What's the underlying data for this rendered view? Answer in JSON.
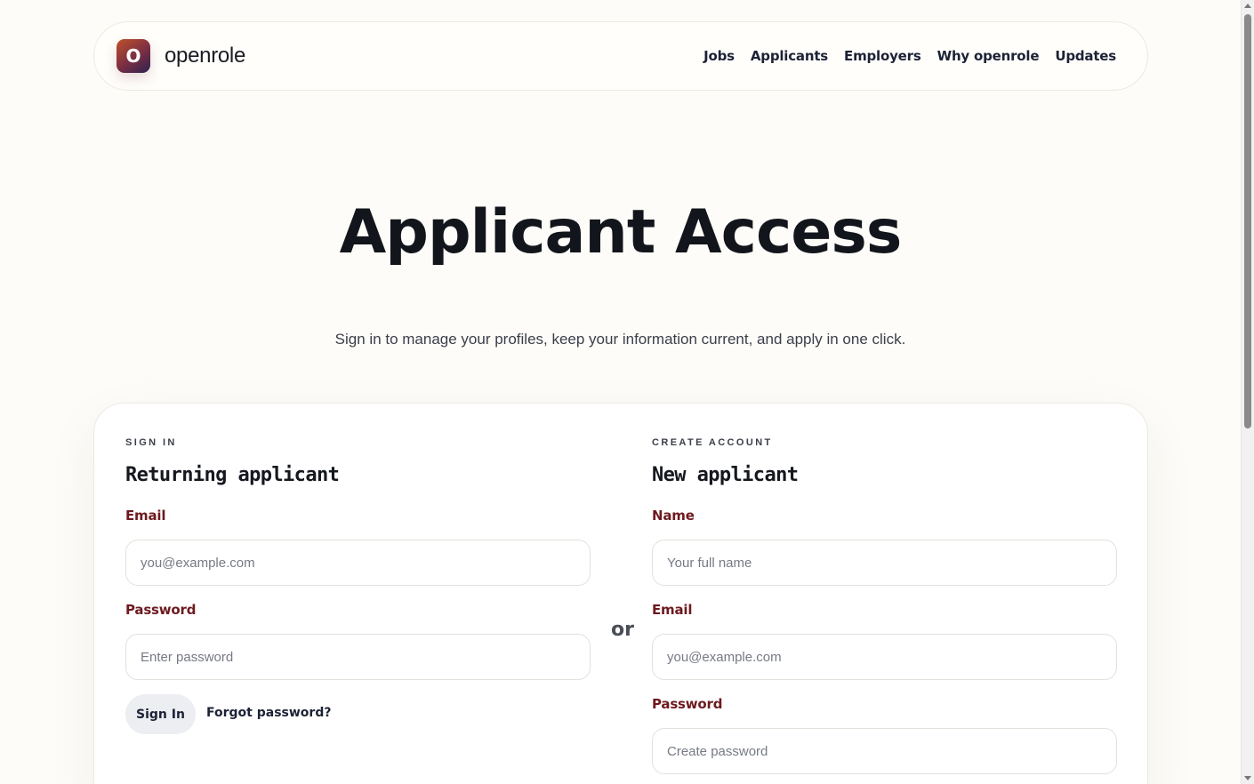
{
  "brand": {
    "logo_letter": "O",
    "name": "openrole"
  },
  "nav": {
    "links": [
      "Jobs",
      "Applicants",
      "Employers",
      "Why openrole",
      "Updates"
    ]
  },
  "hero": {
    "title": "Applicant Access",
    "subtitle": "Sign in to manage your profiles, keep your information current, and apply in one click."
  },
  "signin": {
    "eyebrow": "SIGN IN",
    "title": "Returning applicant",
    "email_label": "Email",
    "email_placeholder": "you@example.com",
    "password_label": "Password",
    "password_placeholder": "Enter password",
    "submit_label": "Sign In",
    "forgot_label": "Forgot password?"
  },
  "divider": {
    "or_label": "or"
  },
  "create": {
    "eyebrow": "CREATE ACCOUNT",
    "title": "New applicant",
    "name_label": "Name",
    "name_placeholder": "Your full name",
    "email_label": "Email",
    "email_placeholder": "you@example.com",
    "password_label": "Password",
    "password_placeholder": "Create password"
  },
  "colors": {
    "page_bg": "#fdfcf8",
    "label_accent": "#6e1a1f",
    "heading": "#12151b",
    "button_bg": "#eceef2"
  }
}
